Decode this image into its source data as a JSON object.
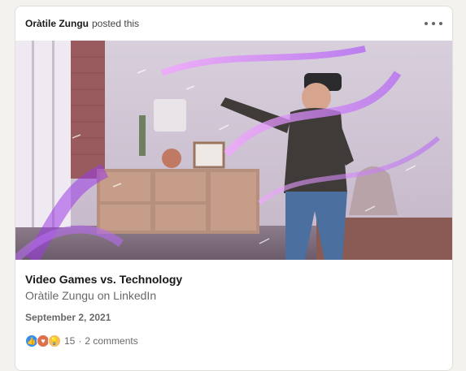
{
  "header": {
    "author": "Oràtile Zungu",
    "action": "posted this"
  },
  "article": {
    "title": "Video Games vs. Technology",
    "source": "Oràtile Zungu on LinkedIn",
    "date": "September 2, 2021"
  },
  "social": {
    "reaction_icons": [
      "like-icon",
      "love-icon",
      "insightful-icon"
    ],
    "reaction_count": "15",
    "separator": "·",
    "comments": "2 comments"
  },
  "colors": {
    "like": "#378fe9",
    "love": "#df704d",
    "insightful": "#f5bb5c",
    "accent_purple": "#b86cf0"
  }
}
